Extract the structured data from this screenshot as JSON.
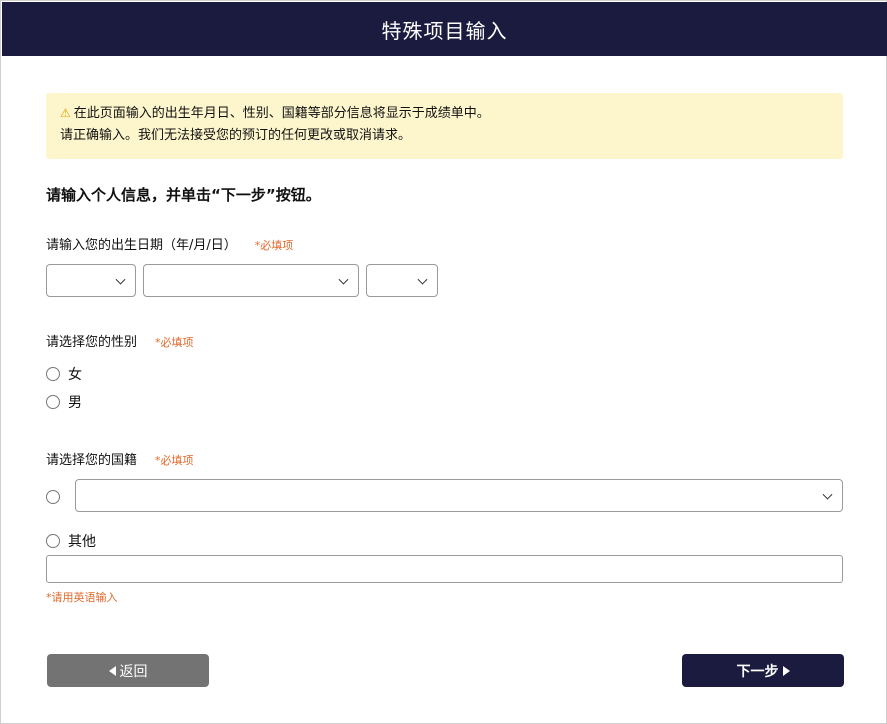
{
  "header": {
    "title": "特殊项目输入"
  },
  "notice": {
    "warning_icon": "⚠",
    "line1": "在此页面输入的出生年月日、性别、国籍等部分信息将显示于成绩单中。",
    "line2": "请正确输入。我们无法接受您的预订的任何更改或取消请求。"
  },
  "instruction": "请输入个人信息，并单击“下一步”按钮。",
  "birthdate": {
    "label": "请输入您的出生日期（年/月/日）",
    "required": "*必填项",
    "year_value": "",
    "month_value": "",
    "day_value": ""
  },
  "gender": {
    "label": "请选择您的性别",
    "required": "*必填项",
    "options": [
      "女",
      "男"
    ]
  },
  "nationality": {
    "label": "请选择您的国籍",
    "required": "*必填项",
    "select_value": "",
    "other_label": "其他",
    "other_value": "",
    "hint": "*请用英语输入"
  },
  "buttons": {
    "back": "返回",
    "next": "下一步"
  },
  "colors": {
    "header_bg": "#1b1a3f",
    "notice_bg": "#fdf5cc",
    "required": "#e26a2c",
    "back_btn": "#737373",
    "next_btn": "#1b1a3f"
  }
}
